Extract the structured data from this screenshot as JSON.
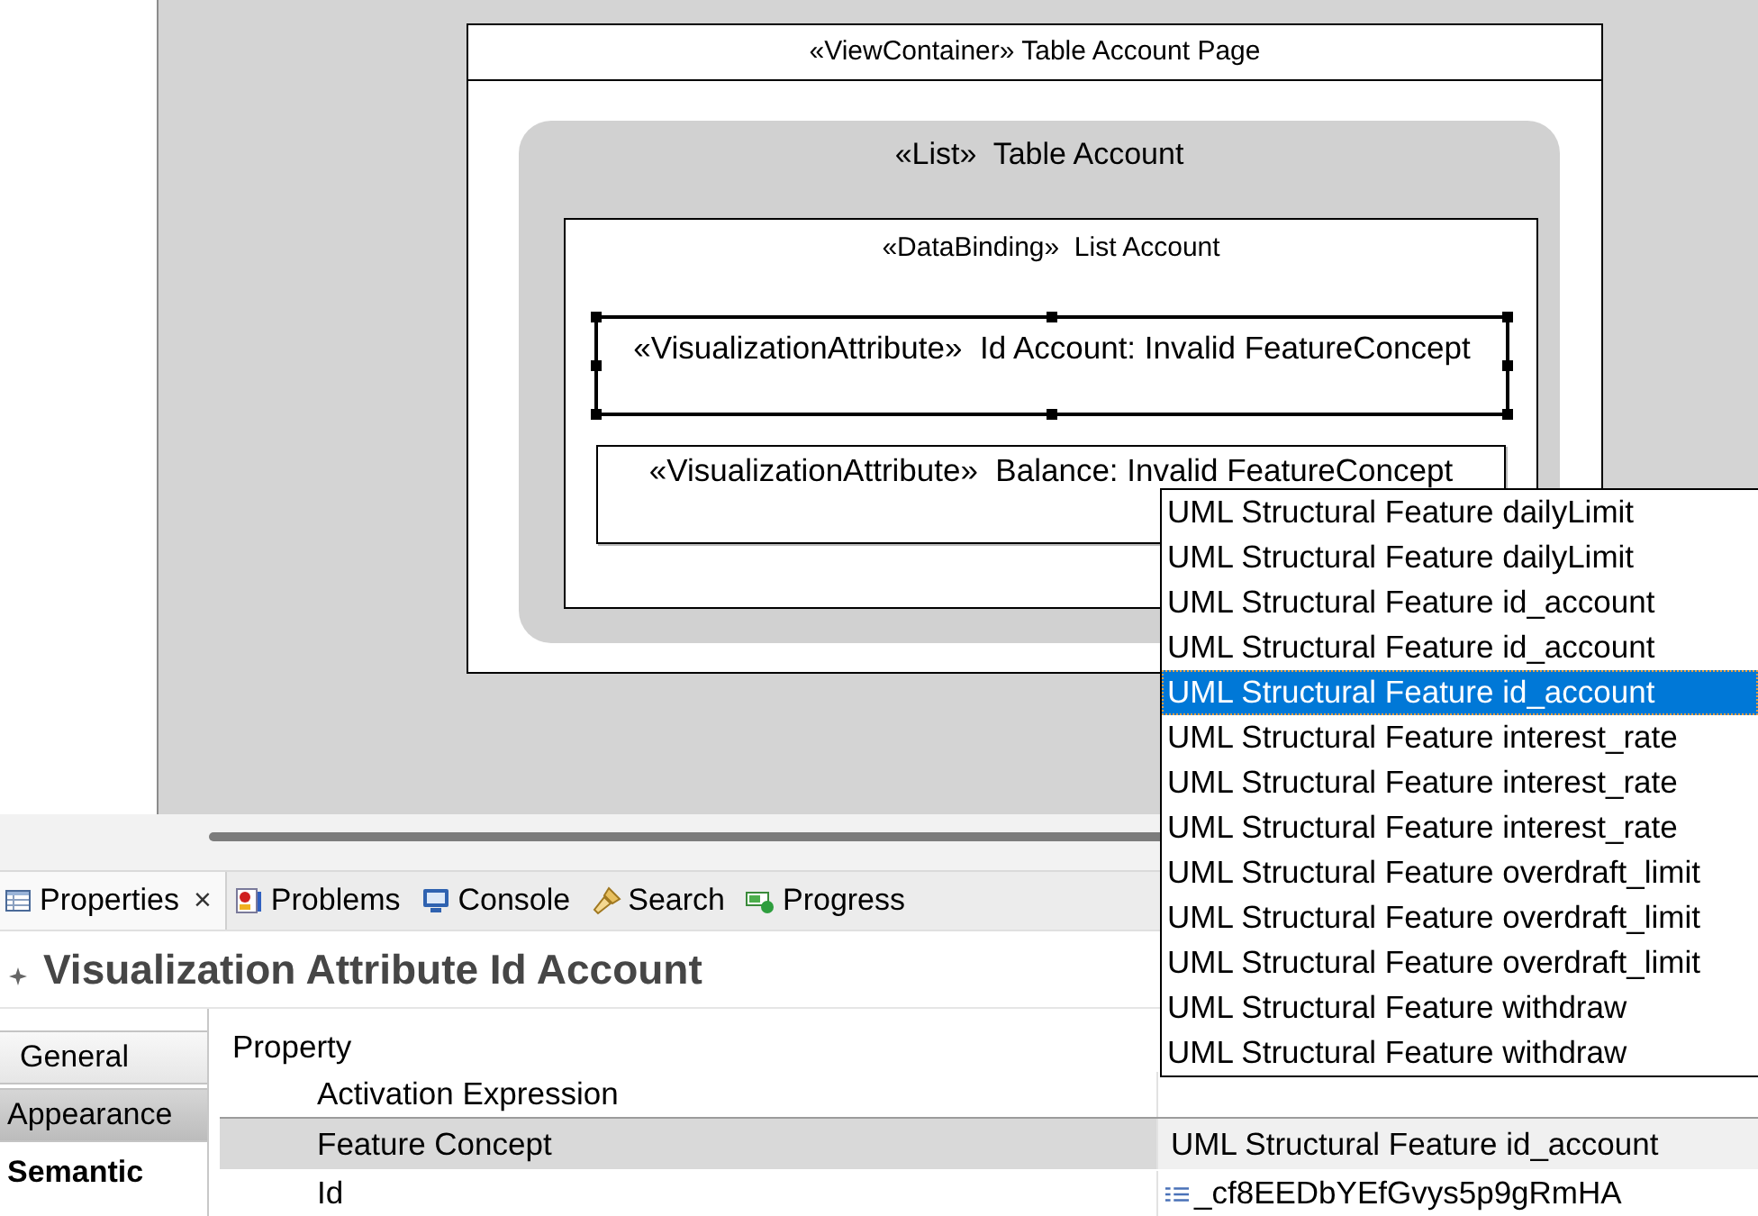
{
  "diagram": {
    "view_container": {
      "title": "«ViewContainer» Table Account Page",
      "list": {
        "title": "«List»  Table Account",
        "data_binding": {
          "title": "«DataBinding»  List Account",
          "attributes": [
            {
              "label": "«VisualizationAttribute»  Id Account: Invalid FeatureConcept",
              "selected": true
            },
            {
              "label": "«VisualizationAttribute»  Balance: Invalid FeatureConcept",
              "selected": false
            }
          ]
        }
      }
    }
  },
  "tabs": [
    {
      "label": "Properties",
      "close": "×",
      "selected": true
    },
    {
      "label": "Problems",
      "selected": false
    },
    {
      "label": "Console",
      "selected": false
    },
    {
      "label": "Search",
      "selected": false
    },
    {
      "label": "Progress",
      "selected": false
    }
  ],
  "properties": {
    "title": "Visualization Attribute Id Account",
    "side_tabs": [
      {
        "label": "General",
        "selected": false,
        "hovered": false
      },
      {
        "label": "Appearance",
        "selected": false,
        "hovered": true
      },
      {
        "label": "Semantic",
        "selected": true,
        "hovered": false
      }
    ],
    "header": "Property",
    "rows": [
      {
        "name": "Activation Expression",
        "kind": "text",
        "selected": false
      },
      {
        "name": "Feature Concept",
        "kind": "combo",
        "value": "UML Structural Feature id_account",
        "selected": true
      },
      {
        "name": "Id",
        "kind": "id",
        "value": "_cf8EEDbYEfGvys5p9gRmHA",
        "selected": false
      }
    ]
  },
  "dropdown": {
    "items": [
      {
        "label": "UML Structural Feature dailyLimit",
        "selected": false
      },
      {
        "label": "UML Structural Feature dailyLimit",
        "selected": false
      },
      {
        "label": "UML Structural Feature id_account",
        "selected": false
      },
      {
        "label": "UML Structural Feature id_account",
        "selected": false
      },
      {
        "label": "UML Structural Feature id_account",
        "selected": true
      },
      {
        "label": "UML Structural Feature interest_rate",
        "selected": false
      },
      {
        "label": "UML Structural Feature interest_rate",
        "selected": false
      },
      {
        "label": "UML Structural Feature interest_rate",
        "selected": false
      },
      {
        "label": "UML Structural Feature overdraft_limit",
        "selected": false
      },
      {
        "label": "UML Structural Feature overdraft_limit",
        "selected": false
      },
      {
        "label": "UML Structural Feature overdraft_limit",
        "selected": false
      },
      {
        "label": "UML Structural Feature withdraw",
        "selected": false
      },
      {
        "label": "UML Structural Feature withdraw",
        "selected": false
      }
    ]
  }
}
